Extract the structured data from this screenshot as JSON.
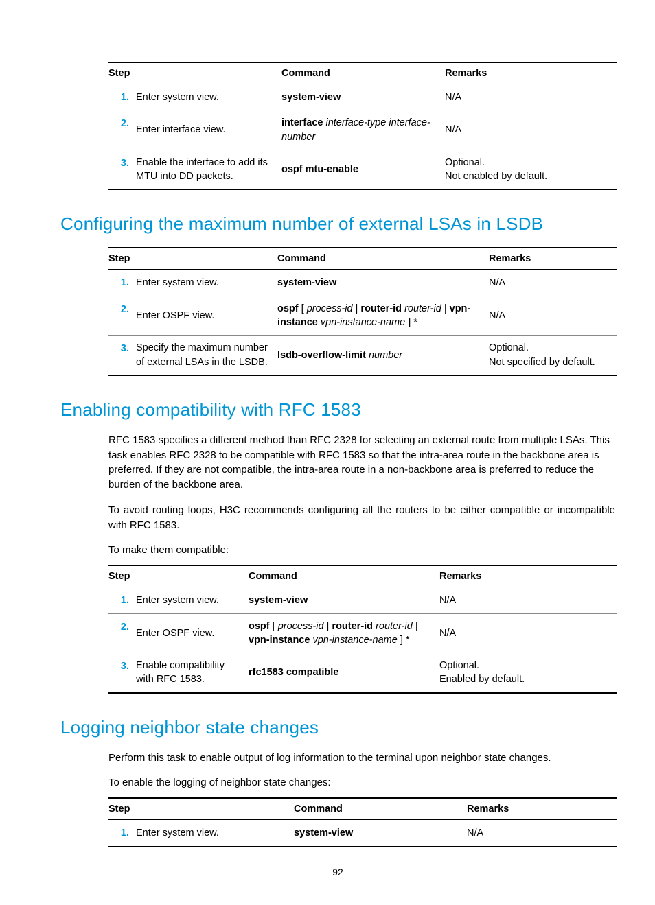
{
  "table1": {
    "headers": {
      "step": "Step",
      "command": "Command",
      "remarks": "Remarks"
    },
    "rows": [
      {
        "n": "1.",
        "step": "Enter system view.",
        "cmd": "<b>system-view</b>",
        "remarks": "N/A"
      },
      {
        "n": "2.",
        "step": "Enter interface view.",
        "cmd": "<b>interface</b> <i>interface-type interface-number</i>",
        "remarks": "N/A"
      },
      {
        "n": "3.",
        "step": "Enable the interface to add its MTU into DD packets.",
        "cmd": "<b>ospf mtu-enable</b>",
        "remarks": "Optional.<br>Not enabled by default."
      }
    ]
  },
  "heading1": "Configuring the maximum number of external LSAs in LSDB",
  "table2": {
    "headers": {
      "step": "Step",
      "command": "Command",
      "remarks": "Remarks"
    },
    "rows": [
      {
        "n": "1.",
        "step": "Enter system view.",
        "cmd": "<b>system-view</b>",
        "remarks": "N/A"
      },
      {
        "n": "2.",
        "step": "Enter OSPF view.",
        "cmd": "<b>ospf</b> [ <i>process-id</i> | <b>router-id</b> <i>router-id</i> | <b>vpn-instance</b> <i>vpn-instance-name</i> ] *",
        "remarks": "N/A"
      },
      {
        "n": "3.",
        "step": "Specify the maximum number of external LSAs in the LSDB.",
        "cmd": "<b>lsdb-overflow-limit</b> <i>number</i>",
        "remarks": "Optional.<br>Not specified by default."
      }
    ]
  },
  "heading2": "Enabling compatibility with RFC 1583",
  "para1": "RFC 1583 specifies a different method than RFC 2328 for selecting an external route from multiple LSAs. This task enables RFC 2328 to be compatible with RFC 1583 so that the intra-area route in the backbone area is preferred. If they are not compatible, the intra-area route in a non-backbone area is preferred to reduce the burden of the backbone area.",
  "para2": "To avoid routing loops, H3C recommends configuring all the routers to be either compatible or incompatible with RFC 1583.",
  "para3": "To make them compatible:",
  "table3": {
    "headers": {
      "step": "Step",
      "command": "Command",
      "remarks": "Remarks"
    },
    "rows": [
      {
        "n": "1.",
        "step": "Enter system view.",
        "cmd": "<b>system-view</b>",
        "remarks": "N/A"
      },
      {
        "n": "2.",
        "step": "Enter OSPF view.",
        "cmd": "<b>ospf</b> [ <i>process-id</i> | <b>router-id</b> <i>router-id</i> | <b>vpn-instance</b> <i>vpn-instance-name</i> ] *",
        "remarks": "N/A"
      },
      {
        "n": "3.",
        "step": "Enable compatibility with RFC 1583.",
        "cmd": "<b>rfc1583 compatible</b>",
        "remarks": "Optional.<br>Enabled by default."
      }
    ]
  },
  "heading3": "Logging neighbor state changes",
  "para4": "Perform this task to enable output of log information to the terminal upon neighbor state changes.",
  "para5": "To enable the logging of neighbor state changes:",
  "table4": {
    "headers": {
      "step": "Step",
      "command": "Command",
      "remarks": "Remarks"
    },
    "rows": [
      {
        "n": "1.",
        "step": "Enter system view.",
        "cmd": "<b>system-view</b>",
        "remarks": "N/A"
      }
    ]
  },
  "pageNumber": "92"
}
